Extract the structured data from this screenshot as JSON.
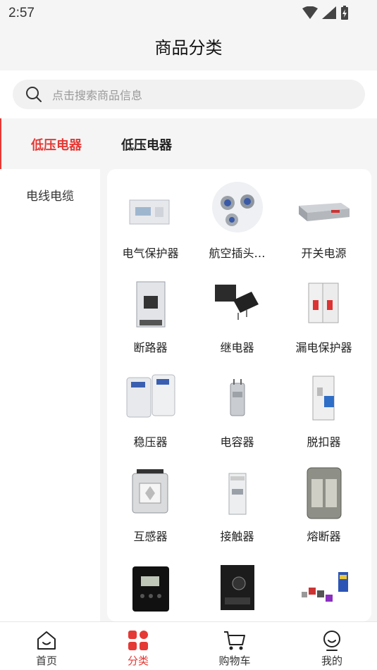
{
  "status": {
    "time": "2:57",
    "icons": [
      "wifi-icon",
      "signal-icon",
      "battery-charging-icon"
    ]
  },
  "header": {
    "title": "商品分类"
  },
  "search": {
    "placeholder": "点击搜索商品信息",
    "icon": "search-icon"
  },
  "top_tabs": [
    {
      "label": "低压电器",
      "active": true
    },
    {
      "label": "低压电器",
      "active": false
    }
  ],
  "side_nav": {
    "items": [
      {
        "label": "电线电缆"
      }
    ]
  },
  "products": [
    {
      "label": "电气保护器",
      "icon": "meter-icon"
    },
    {
      "label": "航空插头…",
      "icon": "connector-icon"
    },
    {
      "label": "开关电源",
      "icon": "power-supply-icon"
    },
    {
      "label": "断路器",
      "icon": "breaker-icon"
    },
    {
      "label": "继电器",
      "icon": "relay-icon"
    },
    {
      "label": "漏电保护器",
      "icon": "rcd-icon"
    },
    {
      "label": "稳压器",
      "icon": "stabilizer-icon"
    },
    {
      "label": "电容器",
      "icon": "capacitor-icon"
    },
    {
      "label": "脱扣器",
      "icon": "trip-unit-icon"
    },
    {
      "label": "互感器",
      "icon": "transformer-icon"
    },
    {
      "label": "接触器",
      "icon": "contactor-icon"
    },
    {
      "label": "熔断器",
      "icon": "fuse-icon"
    },
    {
      "label": "",
      "icon": "controller-icon"
    },
    {
      "label": "",
      "icon": "speed-controller-icon"
    },
    {
      "label": "",
      "icon": "sensor-icon"
    }
  ],
  "bottom_nav": [
    {
      "label": "首页",
      "icon": "home-icon"
    },
    {
      "label": "分类",
      "icon": "category-icon",
      "active": true
    },
    {
      "label": "购物车",
      "icon": "cart-icon"
    },
    {
      "label": "我的",
      "icon": "profile-icon"
    }
  ],
  "colors": {
    "accent": "#e53935",
    "background": "#f5f5f5"
  }
}
